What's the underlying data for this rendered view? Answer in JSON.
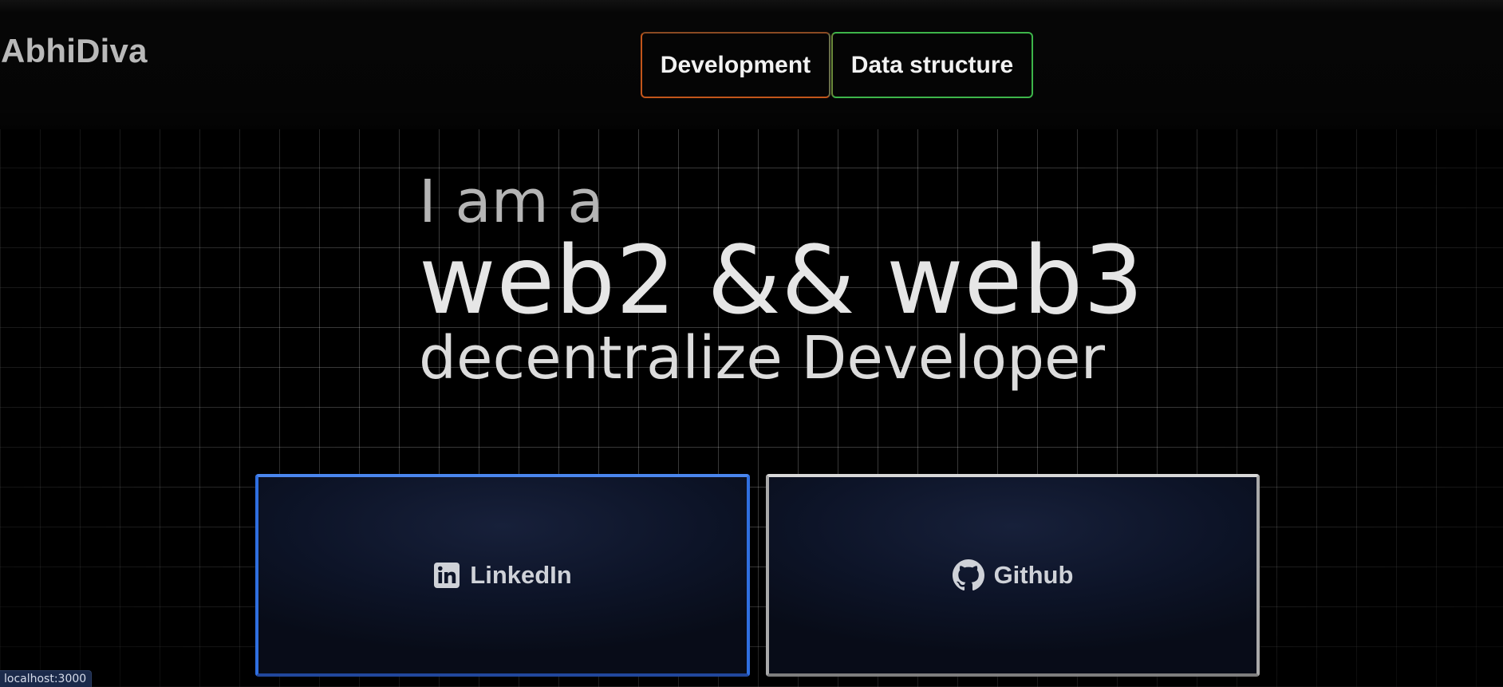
{
  "header": {
    "logo": "AbhiDiva",
    "nav": [
      {
        "label": "Development",
        "border_color": "#c2551a"
      },
      {
        "label": "Data structure",
        "border_color": "#3db54a"
      }
    ]
  },
  "hero": {
    "intro": "I am a",
    "main": "web2 && web3",
    "sub": "decentralize Developer"
  },
  "cards": [
    {
      "label": "LinkedIn",
      "icon": "linkedin-icon",
      "border_color": "#2f6fe0"
    },
    {
      "label": "Github",
      "icon": "github-icon",
      "border_color": "#a9a9a9"
    }
  ],
  "status_bar": {
    "url": "localhost:3000"
  }
}
